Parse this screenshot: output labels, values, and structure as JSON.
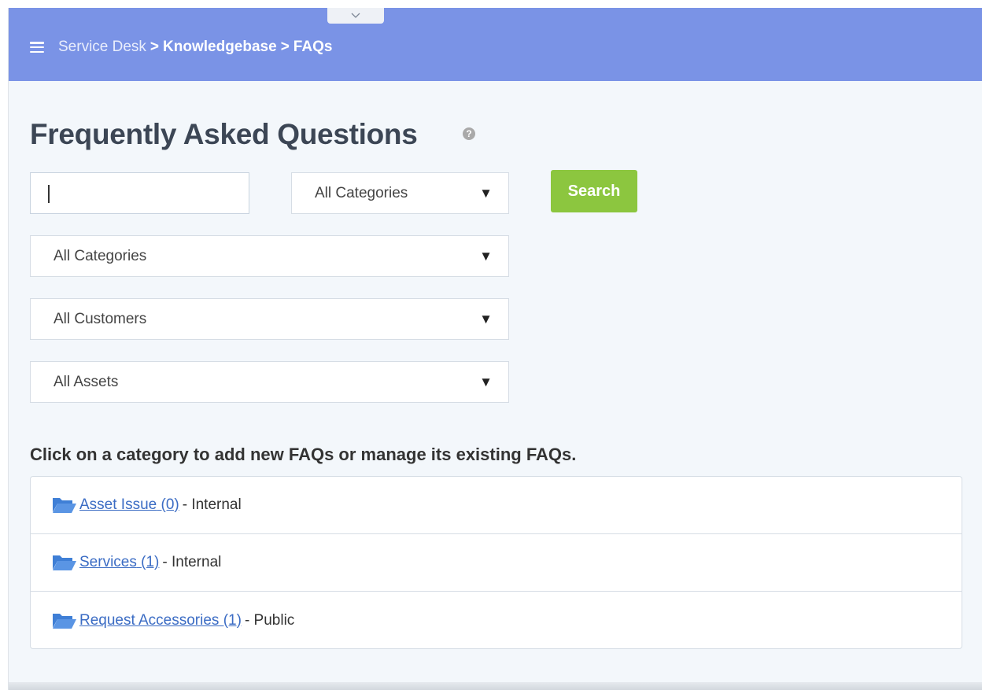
{
  "breadcrumb": {
    "items": [
      "Service Desk",
      "Knowledgebase",
      "FAQs"
    ],
    "separator": ">"
  },
  "page": {
    "title": "Frequently Asked Questions",
    "help_icon_label": "?"
  },
  "search": {
    "input_value": "",
    "category_select": "All Categories",
    "button_label": "Search"
  },
  "filters": {
    "categories": "All Categories",
    "customers": "All Customers",
    "assets": "All Assets",
    "arrow": "▼"
  },
  "instruction": "Click on a category to add new FAQs or manage its existing FAQs.",
  "categories": [
    {
      "name": "Asset Issue",
      "count": "(0)",
      "visibility": "- Internal"
    },
    {
      "name": "Services",
      "count": "(1)",
      "visibility": "- Internal"
    },
    {
      "name": "Request Accessories",
      "count": "(1)",
      "visibility": "- Public"
    }
  ],
  "colors": {
    "topbar": "#7a93e6",
    "search_button": "#8cc63f",
    "link": "#3b6cc4"
  }
}
